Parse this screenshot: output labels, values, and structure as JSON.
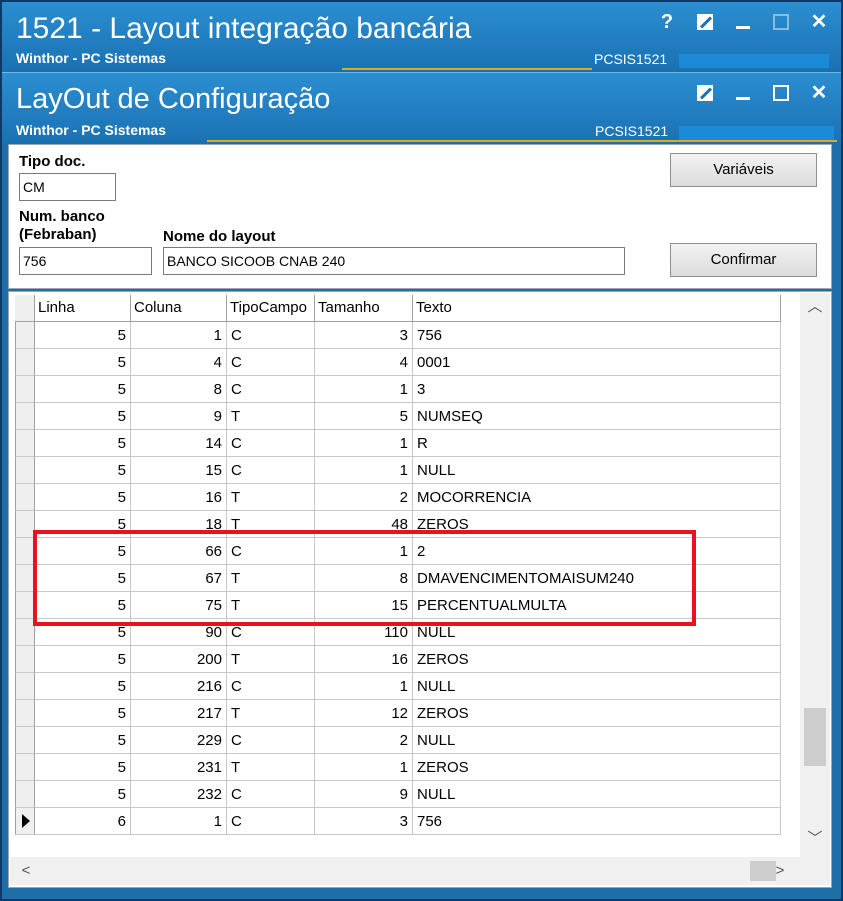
{
  "main_window": {
    "title": "1521 - Layout integração bancária",
    "subtitle": "Winthor - PC Sistemas",
    "code": "PCSIS1521"
  },
  "child_window": {
    "title": "LayOut de Configuração",
    "subtitle": "Winthor - PC Sistemas",
    "code": "PCSIS1521"
  },
  "form": {
    "tipo_doc_label": "Tipo doc.",
    "tipo_doc_value": "CM",
    "num_banco_label_line1": "Num. banco",
    "num_banco_label_line2": "(Febraban)",
    "num_banco_value": "756",
    "nome_layout_label": "Nome do layout",
    "nome_layout_value": "BANCO SICOOB CNAB 240",
    "variaveis_button": "Variáveis",
    "confirmar_button": "Confirmar"
  },
  "grid": {
    "columns": [
      "Linha",
      "Coluna",
      "TipoCampo",
      "Tamanho",
      "Texto"
    ],
    "rows": [
      {
        "linha": "5",
        "coluna": "1",
        "tipo": "C",
        "tamanho": "3",
        "texto": "756"
      },
      {
        "linha": "5",
        "coluna": "4",
        "tipo": "C",
        "tamanho": "4",
        "texto": "0001"
      },
      {
        "linha": "5",
        "coluna": "8",
        "tipo": "C",
        "tamanho": "1",
        "texto": "3"
      },
      {
        "linha": "5",
        "coluna": "9",
        "tipo": "T",
        "tamanho": "5",
        "texto": "NUMSEQ"
      },
      {
        "linha": "5",
        "coluna": "14",
        "tipo": "C",
        "tamanho": "1",
        "texto": "R"
      },
      {
        "linha": "5",
        "coluna": "15",
        "tipo": "C",
        "tamanho": "1",
        "texto": "NULL"
      },
      {
        "linha": "5",
        "coluna": "16",
        "tipo": "T",
        "tamanho": "2",
        "texto": "MOCORRENCIA"
      },
      {
        "linha": "5",
        "coluna": "18",
        "tipo": "T",
        "tamanho": "48",
        "texto": "ZEROS"
      },
      {
        "linha": "5",
        "coluna": "66",
        "tipo": "C",
        "tamanho": "1",
        "texto": "2"
      },
      {
        "linha": "5",
        "coluna": "67",
        "tipo": "T",
        "tamanho": "8",
        "texto": "DMAVENCIMENTOMAISUM240"
      },
      {
        "linha": "5",
        "coluna": "75",
        "tipo": "T",
        "tamanho": "15",
        "texto": "PERCENTUALMULTA"
      },
      {
        "linha": "5",
        "coluna": "90",
        "tipo": "C",
        "tamanho": "110",
        "texto": "NULL"
      },
      {
        "linha": "5",
        "coluna": "200",
        "tipo": "T",
        "tamanho": "16",
        "texto": "ZEROS"
      },
      {
        "linha": "5",
        "coluna": "216",
        "tipo": "C",
        "tamanho": "1",
        "texto": "NULL"
      },
      {
        "linha": "5",
        "coluna": "217",
        "tipo": "T",
        "tamanho": "12",
        "texto": "ZEROS"
      },
      {
        "linha": "5",
        "coluna": "229",
        "tipo": "C",
        "tamanho": "2",
        "texto": "NULL"
      },
      {
        "linha": "5",
        "coluna": "231",
        "tipo": "T",
        "tamanho": "1",
        "texto": "ZEROS"
      },
      {
        "linha": "5",
        "coluna": "232",
        "tipo": "C",
        "tamanho": "9",
        "texto": "NULL"
      },
      {
        "linha": "6",
        "coluna": "1",
        "tipo": "C",
        "tamanho": "3",
        "texto": "756"
      }
    ],
    "current_row_index": 18
  },
  "colors": {
    "titlebar": "#1a72b3",
    "highlight": "#e8141b",
    "accent_line": "#e2a62a"
  }
}
